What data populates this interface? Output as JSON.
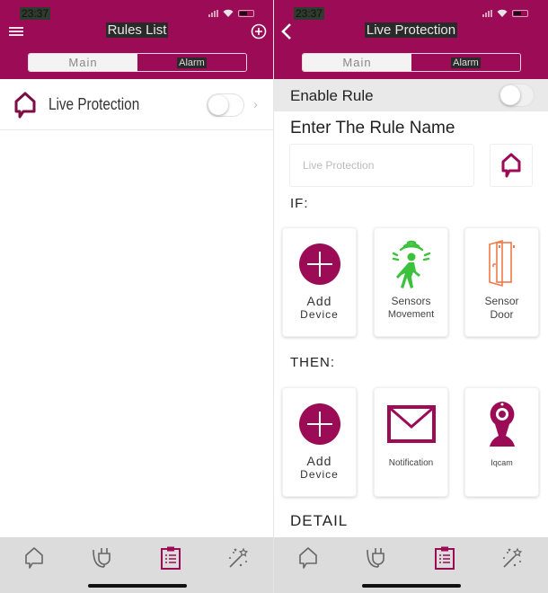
{
  "status_bar": {
    "time": "23:37"
  },
  "colors": {
    "brand": "#9c0b55",
    "sensor_green": "#3cc13c",
    "door_orange": "#ef7a4a",
    "tabbar_bg": "#dcdcdc"
  },
  "left_screen": {
    "header": {
      "title": "Rules List",
      "menu_icon": "hamburger-icon",
      "add_icon": "plus-circle-icon"
    },
    "segments": [
      {
        "label": "Main",
        "active": true
      },
      {
        "label": "Alarm",
        "active": false
      }
    ],
    "rules": [
      {
        "icon": "home-bubble-icon",
        "name": "Live Protection",
        "enabled": false
      }
    ]
  },
  "right_screen": {
    "header": {
      "title": "Live Protection",
      "back_icon": "chevron-left-icon"
    },
    "segments": [
      {
        "label": "Main",
        "active": true
      },
      {
        "label": "Alarm",
        "active": false
      }
    ],
    "enable_rule": {
      "label": "Enable Rule",
      "enabled": false
    },
    "rule_name": {
      "heading": "Enter The Rule Name",
      "placeholder": "Live Protection",
      "value": ""
    },
    "if_section": {
      "label": "IF:",
      "cards": [
        {
          "icon": "add-circle-icon",
          "line1": "Add",
          "line2": "Device"
        },
        {
          "icon": "motion-sensor-icon",
          "line1": "Sensors",
          "line2": "Movement"
        },
        {
          "icon": "door-sensor-icon",
          "line1": "Sensor",
          "line2": "Door"
        }
      ]
    },
    "then_section": {
      "label": "THEN:",
      "cards": [
        {
          "icon": "add-circle-icon",
          "line1": "Add",
          "line2": "Device"
        },
        {
          "icon": "envelope-icon",
          "line1": "Notification",
          "line2": ""
        },
        {
          "icon": "ip-camera-icon",
          "line1": "Iqcam",
          "line2": ""
        }
      ]
    },
    "detail_label": "DETAIL"
  },
  "tabbar": {
    "items": [
      {
        "icon": "home-bubble-icon",
        "active": false
      },
      {
        "icon": "plug-icon",
        "active": false
      },
      {
        "icon": "clipboard-list-icon",
        "active": true
      },
      {
        "icon": "magic-wand-icon",
        "active": false
      }
    ]
  }
}
